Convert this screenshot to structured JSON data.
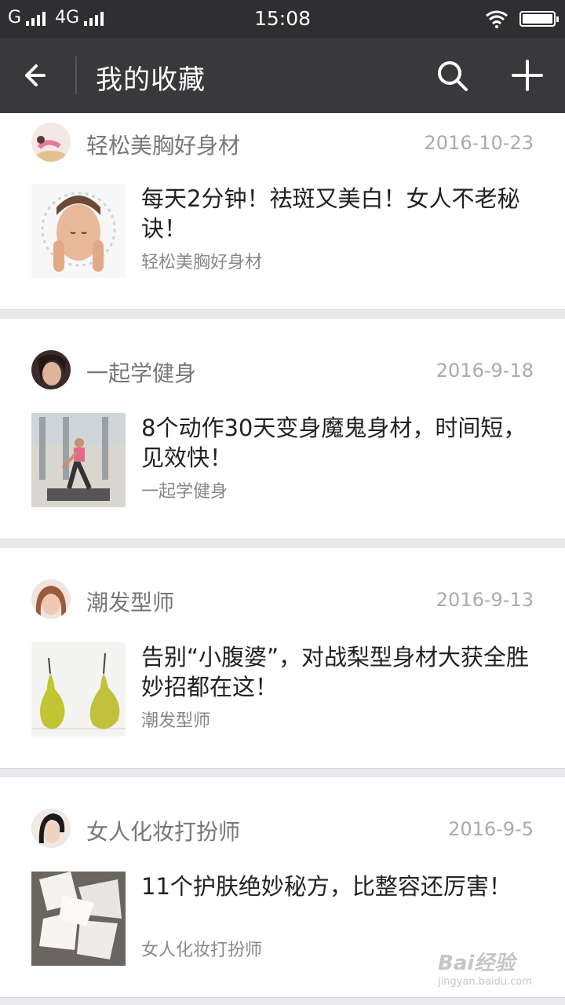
{
  "status_bar": {
    "carrier": "G",
    "network": "4G",
    "time": "15:08"
  },
  "toolbar": {
    "title": "我的收藏",
    "back_icon": "arrow-left-icon",
    "search_icon": "search-icon",
    "add_icon": "plus-icon"
  },
  "favorites": [
    {
      "source": "轻松美胸好身材",
      "date": "2016-10-23",
      "title": "每天2分钟！祛斑又美白！女人不老秘诀！",
      "article_source": "轻松美胸好身材"
    },
    {
      "source": "一起学健身",
      "date": "2016-9-18",
      "title": "8个动作30天变身魔鬼身材，时间短，见效快！",
      "article_source": "一起学健身"
    },
    {
      "source": "潮发型师",
      "date": "2016-9-13",
      "title": "告别“小腹婆”，对战梨型身材大获全胜妙招都在这！",
      "article_source": "潮发型师"
    },
    {
      "source": "女人化妆打扮师",
      "date": "2016-9-5",
      "title": "11个护肤绝妙秘方，比整容还厉害！",
      "article_source": "女人化妆打扮师"
    }
  ],
  "watermark": {
    "text": "Bai经验",
    "url": "jingyan.baidu.com"
  },
  "colors": {
    "toolbar_bg": "#39393b",
    "status_bg": "#2f2f31",
    "page_bg": "#e9e9ec"
  }
}
